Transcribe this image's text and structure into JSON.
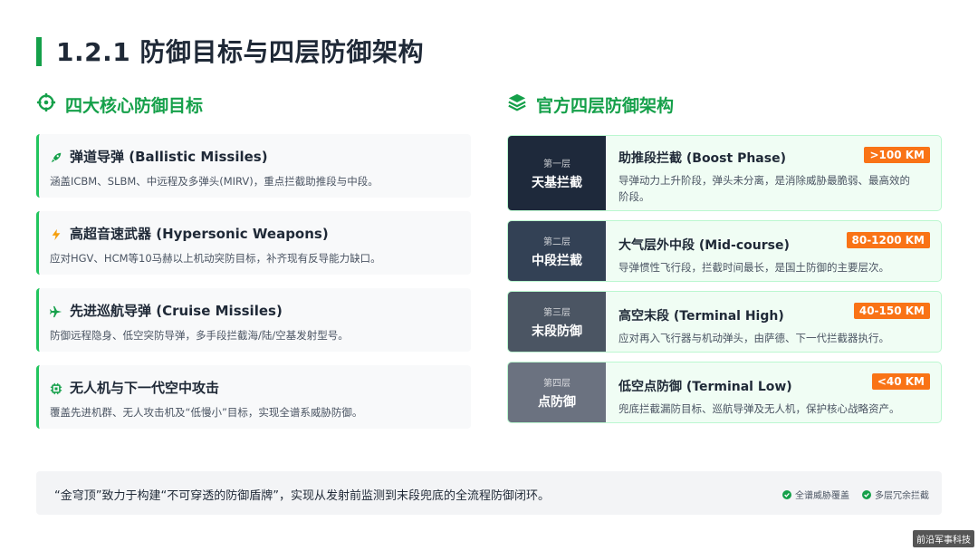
{
  "page": {
    "title": "1.2.1 防御目标与四层防御架构"
  },
  "left_section": {
    "title": "四大核心防御目标",
    "icon": "crosshair-icon",
    "goals": [
      {
        "icon": "rocket-icon",
        "title": "弹道导弹 (Ballistic Missiles)",
        "desc": "涵盖ICBM、SLBM、中远程及多弹头(MIRV)，重点拦截助推段与中段。"
      },
      {
        "icon": "bolt-icon",
        "title": "高超音速武器 (Hypersonic Weapons)",
        "desc": "应对HGV、HCM等10马赫以上机动突防目标，补齐现有反导能力缺口。"
      },
      {
        "icon": "plane-icon",
        "title": "先进巡航导弹 (Cruise Missiles)",
        "desc": "防御远程隐身、低空突防导弹，多手段拦截海/陆/空基发射型号。"
      },
      {
        "icon": "chip-icon",
        "title": "无人机与下一代空中攻击",
        "desc": "覆盖先进机群、无人攻击机及“低慢小”目标，实现全谱系威胁防御。"
      }
    ]
  },
  "right_section": {
    "title": "官方四层防御架构",
    "icon": "layers-icon",
    "layers": [
      {
        "num": "第一层",
        "name": "天基拦截",
        "title": "助推段拦截 (Boost Phase)",
        "desc": "导弹动力上升阶段，弹头未分离，是消除威胁最脆弱、最高效的阶段。",
        "range": ">100 KM",
        "color": "#1e293b"
      },
      {
        "num": "第二层",
        "name": "中段拦截",
        "title": "大气层外中段 (Mid-course)",
        "desc": "导弹惯性飞行段，拦截时间最长，是国土防御的主要层次。",
        "range": "80-1200 KM",
        "color": "#334155"
      },
      {
        "num": "第三层",
        "name": "末段防御",
        "title": "高空末段 (Terminal High)",
        "desc": "应对再入飞行器与机动弹头，由萨德、下一代拦截器执行。",
        "range": "40-150 KM",
        "color": "#4b5563"
      },
      {
        "num": "第四层",
        "name": "点防御",
        "title": "低空点防御 (Terminal Low)",
        "desc": "兜底拦截漏防目标、巡航导弹及无人机，保护核心战略资产。",
        "range": "<40 KM",
        "color": "#6b7280"
      }
    ]
  },
  "footer": {
    "text": "“金穹顶”致力于构建“不可穿透的防御盾牌”，实现从发射前监测到末段兜底的全流程防御闭环。",
    "tags": [
      "全谱威胁覆盖",
      "多层冗余拦截"
    ]
  },
  "watermark": "前沿军事科技",
  "colors": {
    "accent": "#15a04a",
    "badge": "#f97316"
  }
}
